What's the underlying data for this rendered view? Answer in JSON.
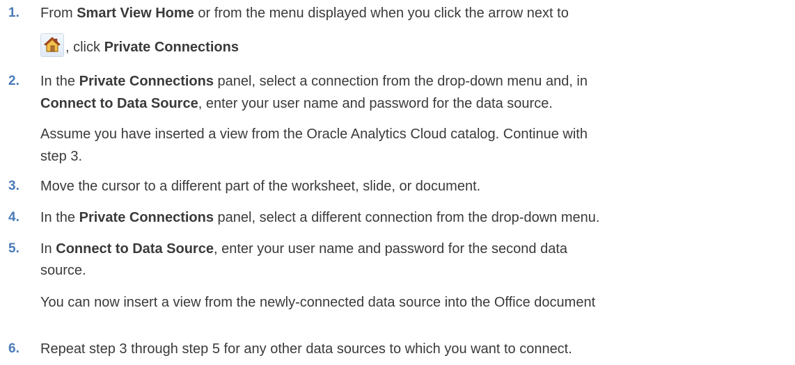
{
  "icons": {
    "home": "home-icon"
  },
  "colors": {
    "step_number": "#4a7bb7",
    "text": "#3a3a3a"
  },
  "steps": [
    {
      "number": "1.",
      "l1_a": "From ",
      "l1_b": "Smart View Home",
      "l1_c": " or from the menu displayed when you click the arrow next to",
      "l2_a": ", click ",
      "l2_b": "Private Connections"
    },
    {
      "number": "2.",
      "l1_a": "In the ",
      "l1_b": "Private Connections",
      "l1_c": " panel, select a connection from the drop-down menu and, in",
      "l2_a": "Connect to Data Source",
      "l2_b": ", enter your user name and password for the data source.",
      "note_1": "Assume you have inserted a view from the Oracle Analytics Cloud catalog. Continue with",
      "note_2": "step 3."
    },
    {
      "number": "3.",
      "text": "Move the cursor to a different part of the worksheet, slide, or document."
    },
    {
      "number": "4.",
      "l1_a": "In the ",
      "l1_b": "Private Connections",
      "l1_c": " panel, select a different connection from the drop-down menu."
    },
    {
      "number": "5.",
      "l1_a": "In ",
      "l1_b": "Connect to Data Source",
      "l1_c": ", enter your user name and password for the second data",
      "l2": "source.",
      "note": "You can now insert a view from the newly-connected data source into the Office document"
    },
    {
      "number": "6.",
      "text": "Repeat step 3 through step 5 for any other data sources to which you want to connect."
    }
  ]
}
